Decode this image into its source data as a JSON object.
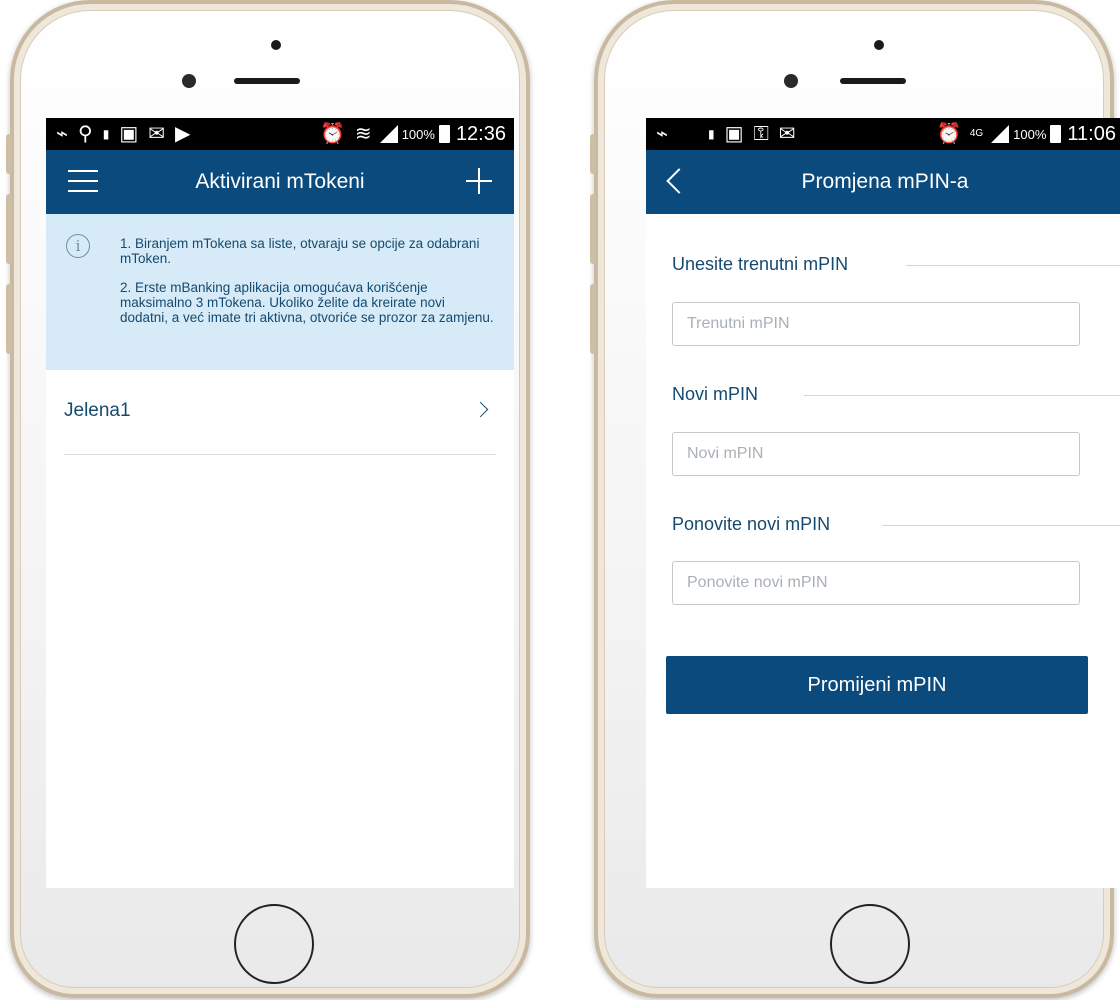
{
  "left_phone": {
    "statusbar": {
      "battery_percent": "100%",
      "time": "12:36",
      "icons": [
        "usb-icon",
        "location-icon",
        "battery-100-icon",
        "image-icon",
        "gmail-icon",
        "play-store-icon",
        "alarm-icon",
        "wifi-icon",
        "signal-icon",
        "battery-icon"
      ]
    },
    "appbar": {
      "title": "Aktivirani mTokeni",
      "left_icon": "menu-icon",
      "right_icon": "plus-icon"
    },
    "info": {
      "icon": "info-icon",
      "paragraph_1": "1. Biranjem mTokena sa liste, otvaraju se opcije za odabrani mToken.",
      "paragraph_2": "2. Erste mBanking aplikacija omogućava korišćenje maksimalno 3 mTokena. Ukoliko želite da kreirate novi dodatni, a već imate tri aktivna, otvoriće se prozor za zamjenu."
    },
    "tokens": [
      {
        "label": "Jelena1"
      }
    ]
  },
  "right_phone": {
    "statusbar": {
      "battery_percent": "100%",
      "time": "11:06",
      "network": "4G",
      "icons": [
        "usb-icon",
        "battery-100-icon",
        "image-icon",
        "key-icon",
        "gmail-icon",
        "alarm-icon",
        "signal-icon",
        "battery-icon"
      ]
    },
    "appbar": {
      "title": "Promjena mPIN-a",
      "left_icon": "back-icon"
    },
    "form": {
      "current_label": "Unesite trenutni mPIN",
      "current_placeholder": "Trenutni mPIN",
      "current_value": "",
      "new_label": "Novi mPIN",
      "new_placeholder": "Novi mPIN",
      "new_value": "",
      "repeat_label": "Ponovite novi mPIN",
      "repeat_placeholder": "Ponovite novi mPIN",
      "repeat_value": "",
      "submit_label": "Promijeni mPIN"
    }
  },
  "colors": {
    "brand_blue": "#0b4a7d",
    "info_background": "#d6ebf7",
    "text_blue": "#154a70"
  }
}
